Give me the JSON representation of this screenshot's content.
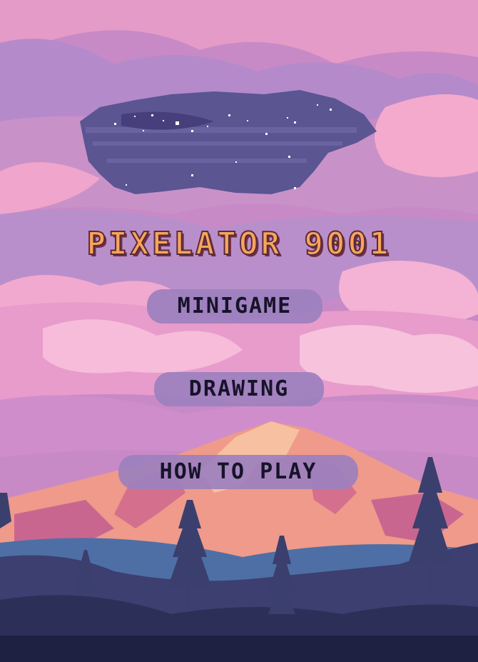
{
  "game": {
    "title": "PIXELATOR 9001"
  },
  "menu": {
    "minigame_label": "MINIGAME",
    "drawing_label": "DRAWING",
    "how_to_play_label": "HOW TO PLAY"
  },
  "colors": {
    "title_fill": "#f7a55a",
    "title_outline": "#5a2a3a",
    "button_bg": "#9c80be",
    "button_text": "#17132a",
    "sky_pink": "#c98bc4",
    "cloud_pink": "#e898c6",
    "cloud_lilac": "#b08cc9",
    "night_patch": "#4f4a86",
    "mountain_peach": "#f29a86",
    "mountain_shadow": "#d56f8d",
    "forest_dark": "#3d3f6e",
    "ground_navy": "#1e2142"
  }
}
